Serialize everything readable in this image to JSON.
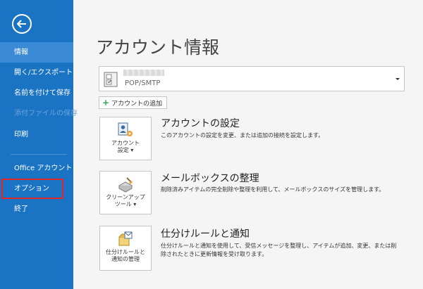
{
  "sidebar": {
    "items": [
      {
        "label": "情報"
      },
      {
        "label": "開く/エクスポート"
      },
      {
        "label": "名前を付けて保存"
      },
      {
        "label": "添付ファイルの保存"
      },
      {
        "label": "印刷"
      },
      {
        "label": "Office アカウント"
      },
      {
        "label": "オプション"
      },
      {
        "label": "終了"
      }
    ]
  },
  "main": {
    "title": "アカウント情報",
    "account": {
      "type": "POP/SMTP"
    },
    "add_account_label": "アカウントの追加",
    "sections": [
      {
        "button_line1": "アカウント",
        "button_line2": "設定",
        "title": "アカウントの設定",
        "description": "このアカウントの設定を変更、または追加の接続を設定します。"
      },
      {
        "button_line1": "クリーンアップ",
        "button_line2": "ツール",
        "title": "メールボックスの整理",
        "description": "削除済みアイテムの完全削除や整理を利用して、メールボックスのサイズを管理します。"
      },
      {
        "button_line1": "仕分けルールと",
        "button_line2": "通知の管理",
        "title": "仕分けルールと通知",
        "description": "仕分けルールと通知を使用して、受信メッセージを整理し、アイテムが追加、変更、または削除されたときに更新情報を受け取ります。"
      }
    ]
  },
  "colors": {
    "sidebar_bg": "#1b73c4",
    "sidebar_active": "#3a8ad6",
    "highlight": "#e32626"
  }
}
